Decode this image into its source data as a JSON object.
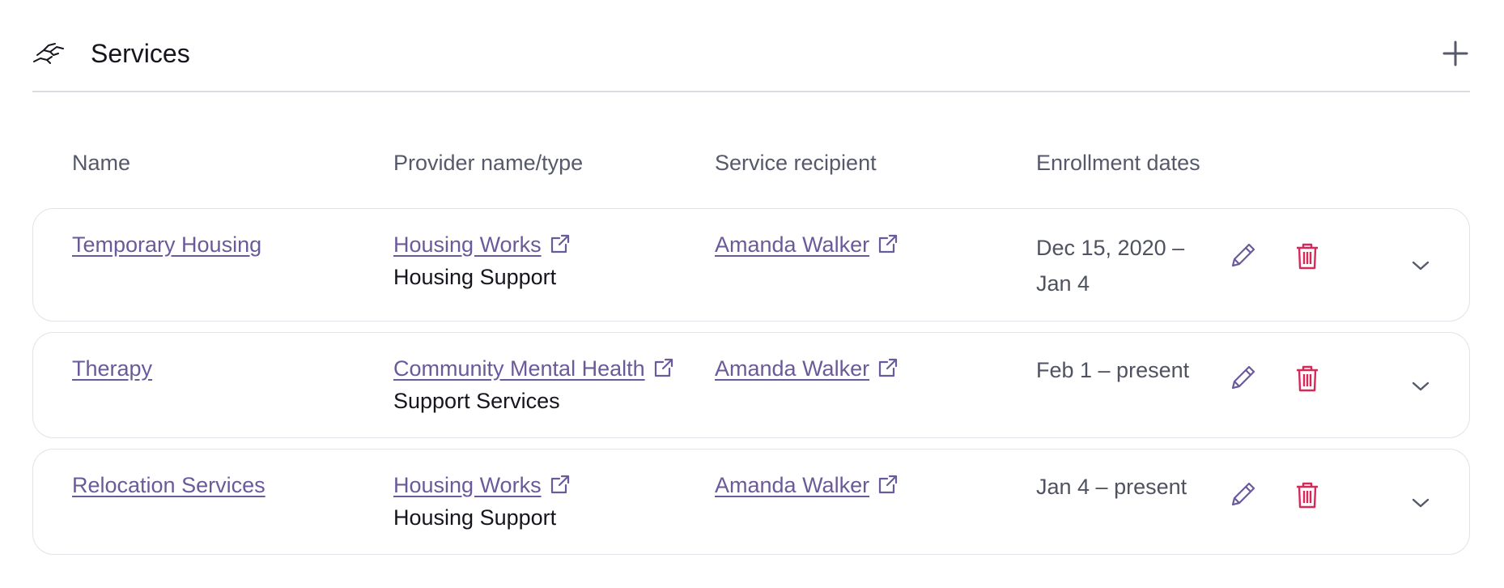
{
  "header": {
    "title": "Services"
  },
  "columns": {
    "name": "Name",
    "provider": "Provider name/type",
    "recipient": "Service recipient",
    "dates": "Enrollment dates"
  },
  "rows": [
    {
      "name": "Temporary Housing",
      "provider_name": "Housing Works",
      "provider_type": "Housing Support",
      "recipient": "Amanda Walker",
      "dates_line1": "Dec 15, 2020 –",
      "dates_line2": "Jan 4"
    },
    {
      "name": "Therapy",
      "provider_name": "Community Mental Health",
      "provider_type": "Support Services",
      "recipient": "Amanda Walker",
      "dates_line1": "Feb 1 – present",
      "dates_line2": ""
    },
    {
      "name": "Relocation Services",
      "provider_name": "Housing Works",
      "provider_type": "Housing Support",
      "recipient": "Amanda Walker",
      "dates_line1": "Jan 4 – present",
      "dates_line2": ""
    }
  ],
  "colors": {
    "link": "#6b5a9a",
    "edit_icon": "#6b5a9a",
    "delete_icon": "#d6295a",
    "border": "#e1e3e8"
  },
  "icons": {
    "section": "handshake-icon",
    "add": "plus-icon",
    "external": "external-link-icon",
    "edit": "pencil-icon",
    "delete": "trash-icon",
    "expand": "chevron-down-icon"
  }
}
